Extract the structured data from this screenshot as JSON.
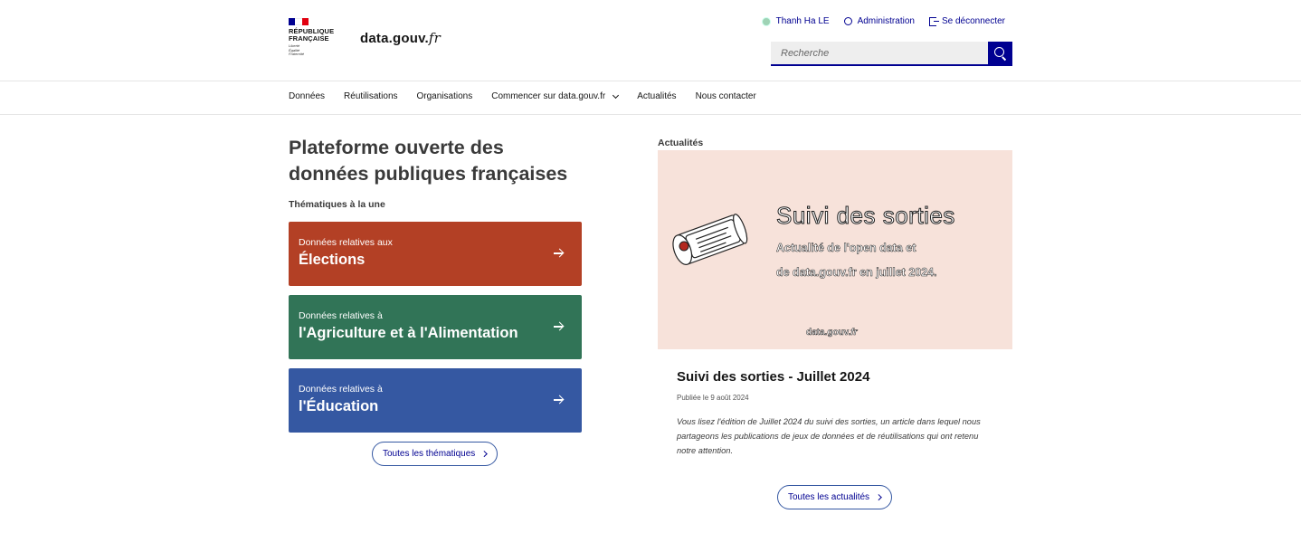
{
  "header": {
    "republic_line1": "RÉPUBLIQUE",
    "republic_line2": "FRANÇAISE",
    "motto_1": "Liberté",
    "motto_2": "Égalité",
    "motto_3": "Fraternité",
    "site_name_main": "data.gouv.",
    "site_name_ext": "fr",
    "tools": {
      "user": "Thanh Ha LE",
      "admin": "Administration",
      "logout": "Se déconnecter"
    },
    "search": {
      "placeholder": "Recherche"
    }
  },
  "nav": {
    "items": [
      "Données",
      "Réutilisations",
      "Organisations",
      "Commencer sur data.gouv.fr",
      "Actualités",
      "Nous contacter"
    ]
  },
  "hero": {
    "title": "Plateforme ouverte des données publiques françaises",
    "themes_label": "Thématiques à la une",
    "cards": [
      {
        "small": "Données relatives aux",
        "big": "Élections",
        "color": "#b34025"
      },
      {
        "small": "Données relatives à",
        "big": "l'Agriculture et à l'Alimentation",
        "color": "#317457"
      },
      {
        "small": "Données relatives à",
        "big": "l'Éducation",
        "color": "#3558a2"
      }
    ],
    "all_themes": "Toutes les thématiques"
  },
  "news": {
    "label": "Actualités",
    "image": {
      "title": "Suivi des sorties",
      "sub1": "Actualité de l'open data et",
      "sub2": "de data.gouv.fr en juillet 2024.",
      "brand_main": "data.gouv.",
      "brand_ext": "fr"
    },
    "title": "Suivi des sorties - Juillet 2024",
    "date": "Publiée le 9 août 2024",
    "description": "Vous lisez l'édition de Juillet 2024 du suivi des sorties, un article dans lequel nous partageons les publications de jeux de données et de réutilisations qui ont retenu notre attention.",
    "all_news": "Toutes les actualités"
  },
  "colors": {
    "primary": "#000091",
    "elections": "#b34025",
    "agriculture": "#317457",
    "education": "#3558a2",
    "news_bg": "#f7e2da"
  }
}
